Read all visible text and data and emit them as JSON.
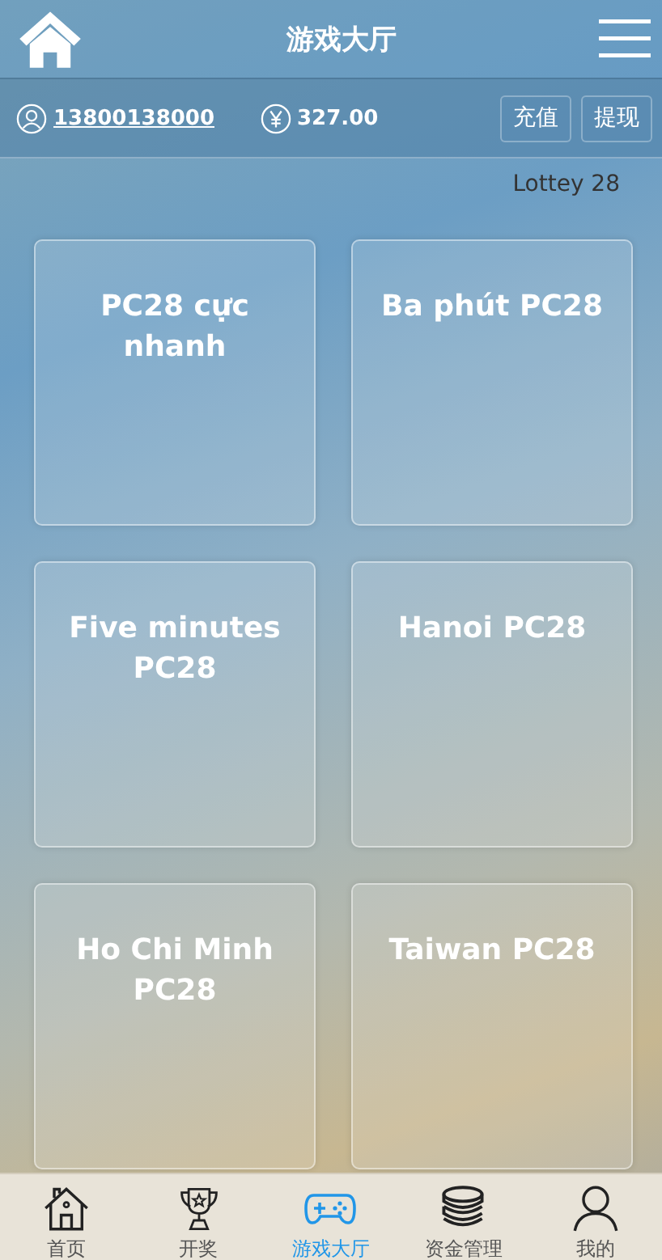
{
  "header": {
    "title": "游戏大厅"
  },
  "account": {
    "phone": "13800138000",
    "balance": "327.00",
    "buttons": [
      "充值",
      "提现"
    ]
  },
  "section_label": "Lottey 28",
  "games": [
    {
      "name": "PC28 cực nhanh"
    },
    {
      "name": "Ba phút PC28"
    },
    {
      "name": "Five minutes PC28"
    },
    {
      "name": "Hanoi PC28"
    },
    {
      "name": "Ho Chi Minh PC28"
    },
    {
      "name": "Taiwan PC28"
    }
  ],
  "tabbar": [
    {
      "kind": "home",
      "label": "首页",
      "selected": false
    },
    {
      "kind": "trophy",
      "label": "开奖",
      "selected": false
    },
    {
      "kind": "gamepad",
      "label": "游戏大厅",
      "selected": true
    },
    {
      "kind": "coins",
      "label": "资金管理",
      "selected": false
    },
    {
      "kind": "person",
      "label": "我的",
      "selected": false
    }
  ]
}
